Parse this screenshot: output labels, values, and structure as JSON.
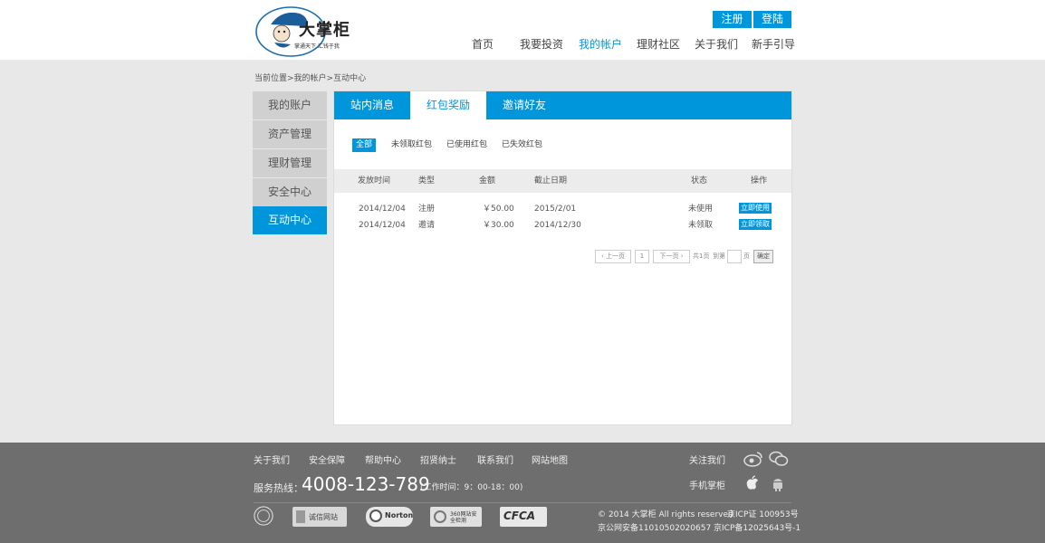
{
  "header": {
    "logo_text": "大掌柜",
    "logo_slogan": "掌通天下  汇钱于我",
    "register_label": "注册",
    "login_label": "登陆",
    "nav": [
      "首页",
      "我要投资",
      "我的帐户",
      "理财社区",
      "关于我们",
      "新手引导"
    ]
  },
  "breadcrumb": "当前位置>我的帐户>互动中心",
  "sidebar": {
    "items": [
      "我的账户",
      "资产管理",
      "理财管理",
      "安全中心",
      "互动中心"
    ]
  },
  "tabs": [
    "站内消息",
    "红包奖励",
    "邀请好友"
  ],
  "filters": [
    "全部",
    "未领取红包",
    "已使用红包",
    "已失效红包"
  ],
  "table": {
    "headers": [
      "发放时间",
      "类型",
      "金额",
      "截止日期",
      "状态",
      "操作"
    ],
    "rows": [
      {
        "date": "2014/12/04",
        "type": "注册",
        "amount": "￥50.00",
        "deadline": "2015/2/01",
        "status": "未使用",
        "action": "立即使用"
      },
      {
        "date": "2014/12/04",
        "type": "邀请",
        "amount": "￥30.00",
        "deadline": "2014/12/30",
        "status": "未领取",
        "action": "立即领取"
      }
    ]
  },
  "pager": {
    "prev": "上一页",
    "page": "1",
    "next": "下一页",
    "total": "共1页",
    "goto": "到第",
    "unit": "页",
    "ok": "确定"
  },
  "footer": {
    "links": [
      "关于我们",
      "安全保障",
      "帮助中心",
      "招贤纳士",
      "联系我们",
      "网站地图"
    ],
    "hotline_label": "服务热线：",
    "hotline": "4008-123-789",
    "hours": "(工作时间：9：00-18：00)",
    "follow_label": "关注我们",
    "mobile_label": "手机掌柜",
    "badges": [
      "诚信网站",
      "Norton",
      "360网站安全检测",
      "CFCA"
    ],
    "copyright": "© 2014 大掌柜 All rights reserved",
    "icp1": "京ICP证 100953号",
    "police": "京公网安备11010502020657",
    "icp2": "京ICP备12025643号-1"
  },
  "colors": {
    "accent": "#0096dc",
    "footer_bg": "#6e6e6e",
    "page_bg": "#e8e8e8"
  }
}
